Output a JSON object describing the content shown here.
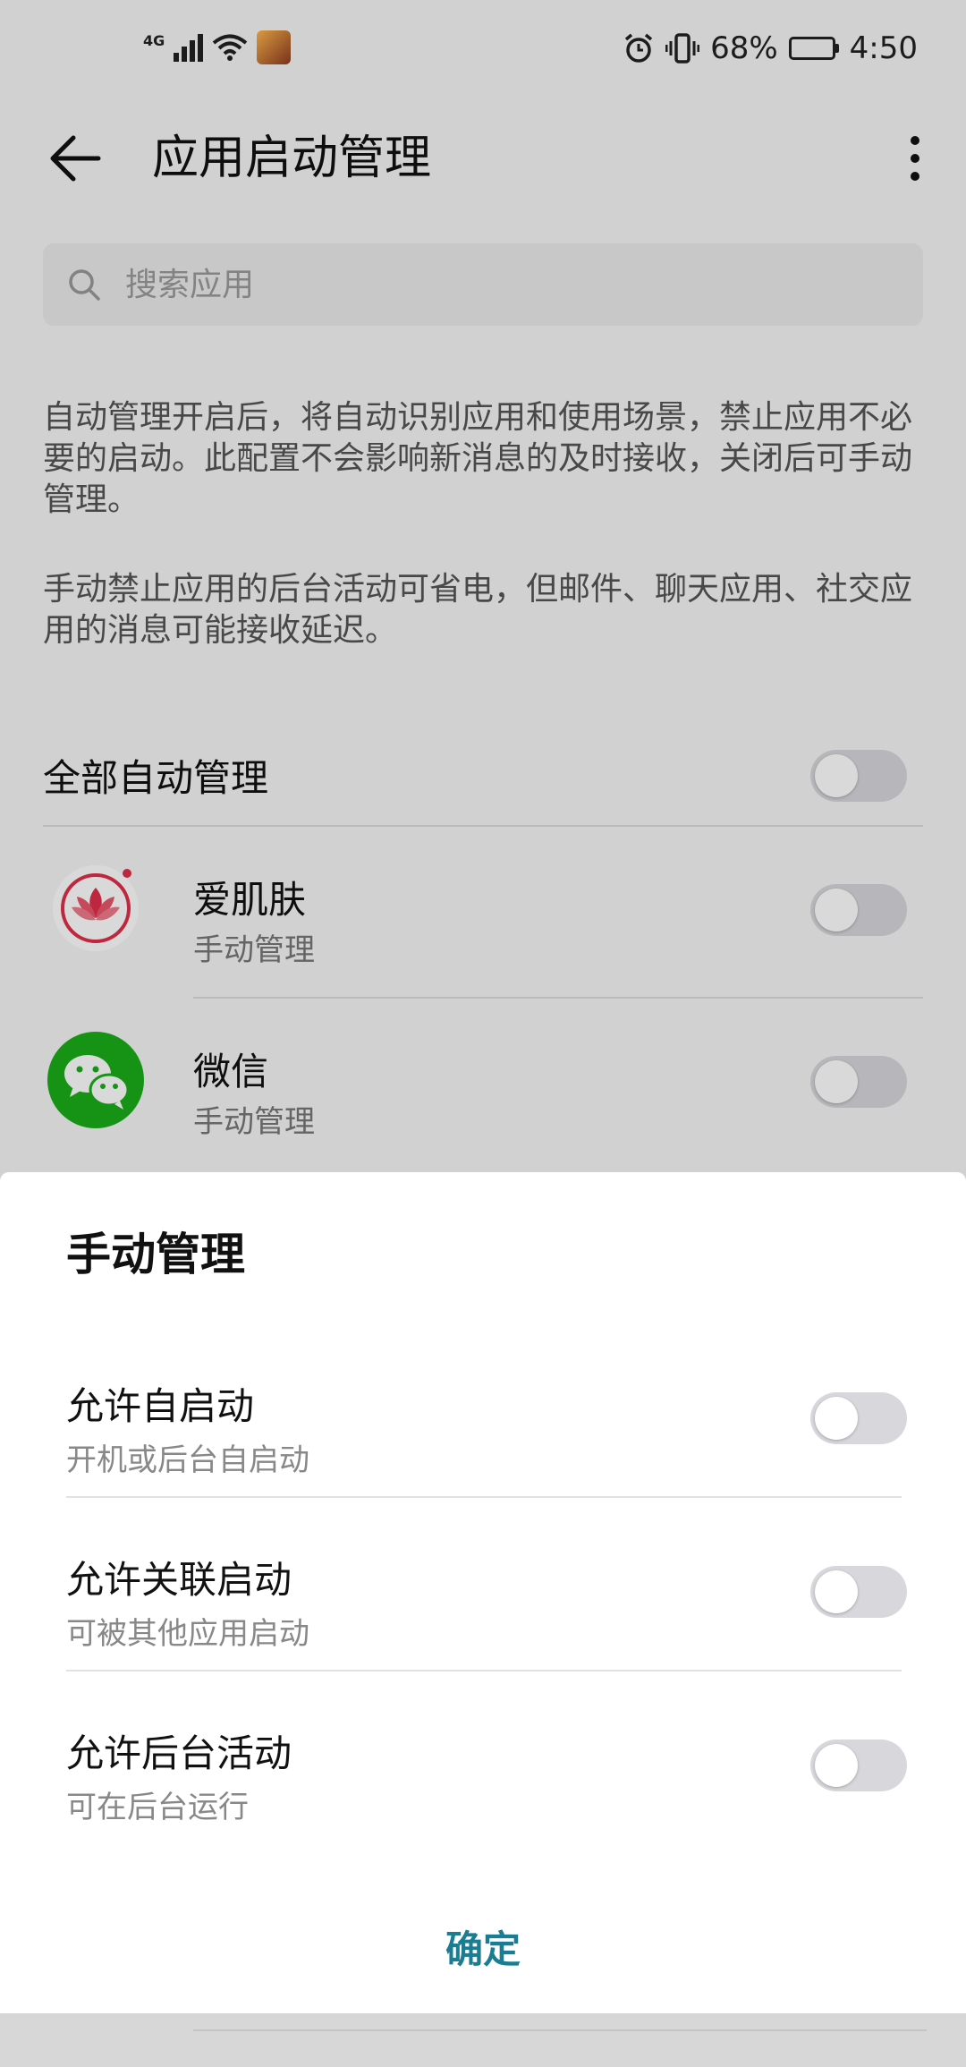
{
  "status_bar": {
    "network_type": "4G",
    "battery_text": "68%",
    "battery_level": 0.68,
    "time": "4:50"
  },
  "app_bar": {
    "title": "应用启动管理",
    "back_icon": "back-arrow-icon",
    "more_icon": "more-vertical-icon"
  },
  "search": {
    "placeholder": "搜索应用"
  },
  "description": {
    "paragraph_1": "自动管理开启后，将自动识别应用和使用场景，禁止应用不必要的启动。此配置不会影响新消息的及时接收，关闭后可手动管理。",
    "paragraph_2": "手动禁止应用的后台活动可省电，但邮件、聊天应用、社交应用的消息可能接收延迟。"
  },
  "all_auto": {
    "label": "全部自动管理",
    "enabled": false
  },
  "apps": [
    {
      "name": "爱肌肤",
      "mode": "手动管理",
      "icon": "lotus-icon",
      "enabled": false
    },
    {
      "name": "微信",
      "mode": "手动管理",
      "icon": "wechat-icon",
      "enabled": false
    }
  ],
  "sheet": {
    "title": "手动管理",
    "options": [
      {
        "label": "允许自启动",
        "sub": "开机或后台自启动",
        "enabled": false
      },
      {
        "label": "允许关联启动",
        "sub": "可被其他应用启动",
        "enabled": false
      },
      {
        "label": "允许后台活动",
        "sub": "可在后台运行",
        "enabled": false
      }
    ],
    "confirm_label": "确定"
  },
  "colors": {
    "accent": "#1a7d92",
    "wechat_green": "#1aad19",
    "lotus_red": "#e0304a"
  }
}
